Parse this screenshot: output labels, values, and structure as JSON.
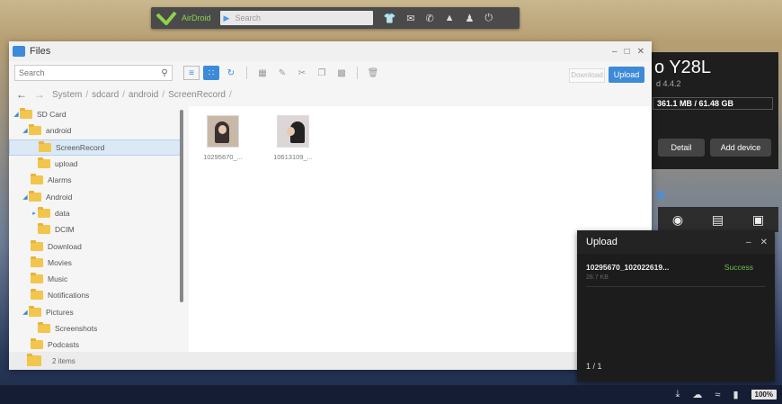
{
  "topbar": {
    "brand": "AirDroid",
    "search_placeholder": "Search",
    "icons": [
      "shirt-icon",
      "mail-icon",
      "phone-icon",
      "upload-icon",
      "user-icon",
      "power-icon"
    ]
  },
  "files_window": {
    "title": "Files",
    "search_placeholder": "Search",
    "download_label": "Download",
    "upload_label": "Upload",
    "breadcrumb": [
      "System",
      "sdcard",
      "android",
      "ScreenRecord"
    ],
    "tree": [
      {
        "label": "SD Card",
        "expanded": true
      },
      {
        "label": "android",
        "expanded": true
      },
      {
        "label": "ScreenRecord",
        "selected": true
      },
      {
        "label": "upload"
      },
      {
        "label": "Alarms"
      },
      {
        "label": "Android",
        "expanded": true
      },
      {
        "label": "data",
        "collapsed": true
      },
      {
        "label": "DCIM"
      },
      {
        "label": "Download"
      },
      {
        "label": "Movies"
      },
      {
        "label": "Music"
      },
      {
        "label": "Notifications"
      },
      {
        "label": "Pictures",
        "expanded": true
      },
      {
        "label": "Screenshots"
      },
      {
        "label": "Podcasts"
      }
    ],
    "files": [
      {
        "name": "10295670_..."
      },
      {
        "name": "10613109_..."
      }
    ],
    "status": "2 items"
  },
  "device": {
    "name": "o Y28L",
    "version": "d 4.4.2",
    "storage": "361.1 MB / 61.48 GB",
    "detail_label": "Detail",
    "add_device_label": "Add device"
  },
  "upload_panel": {
    "title": "Upload",
    "file_name": "10295670_102022619...",
    "file_size": "28.7 KB",
    "status": "Success",
    "count": "1 / 1"
  },
  "taskbar": {
    "battery": "100%"
  },
  "colors": {
    "accent": "#3c8ad8",
    "success": "#6cc04a",
    "brand_green": "#8fd14f"
  }
}
